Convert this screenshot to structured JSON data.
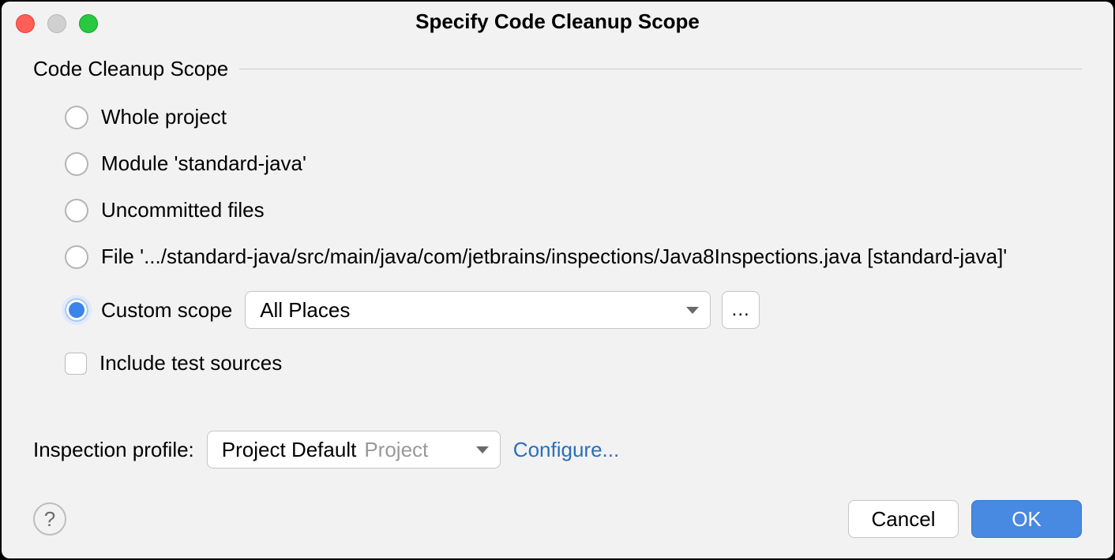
{
  "dialog": {
    "title": "Specify Code Cleanup Scope"
  },
  "section": {
    "label": "Code Cleanup Scope"
  },
  "options": {
    "whole_project": "Whole project",
    "module": "Module 'standard-java'",
    "uncommitted": "Uncommitted files",
    "file": "File '.../standard-java/src/main/java/com/jetbrains/inspections/Java8Inspections.java [standard-java]'",
    "custom_scope": "Custom scope",
    "custom_scope_value": "All Places",
    "ellipsis": "...",
    "include_test": "Include test sources"
  },
  "inspection": {
    "label": "Inspection profile:",
    "profile_name": "Project Default",
    "profile_secondary": "Project",
    "configure": "Configure..."
  },
  "buttons": {
    "help": "?",
    "cancel": "Cancel",
    "ok": "OK"
  }
}
